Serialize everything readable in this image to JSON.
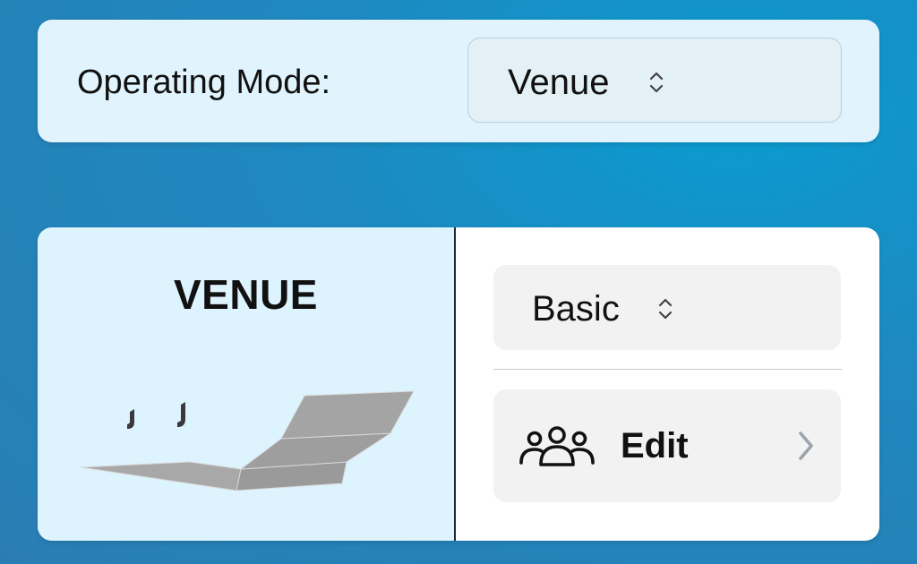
{
  "operating_mode": {
    "label": "Operating Mode:",
    "selected_value": "Venue"
  },
  "venue_card": {
    "title": "VENUE",
    "illustration_icon": "venue-stage-illustration-icon",
    "profile_select": {
      "selected_value": "Basic"
    },
    "edit": {
      "label": "Edit",
      "icon": "people-group-icon"
    }
  },
  "colors": {
    "background": "#1f88bf",
    "top_panel": "#e1f4fd",
    "venue_left_panel": "#ddf3fd",
    "row_background": "#f2f2f3",
    "chevron": "#9aa3ab"
  }
}
